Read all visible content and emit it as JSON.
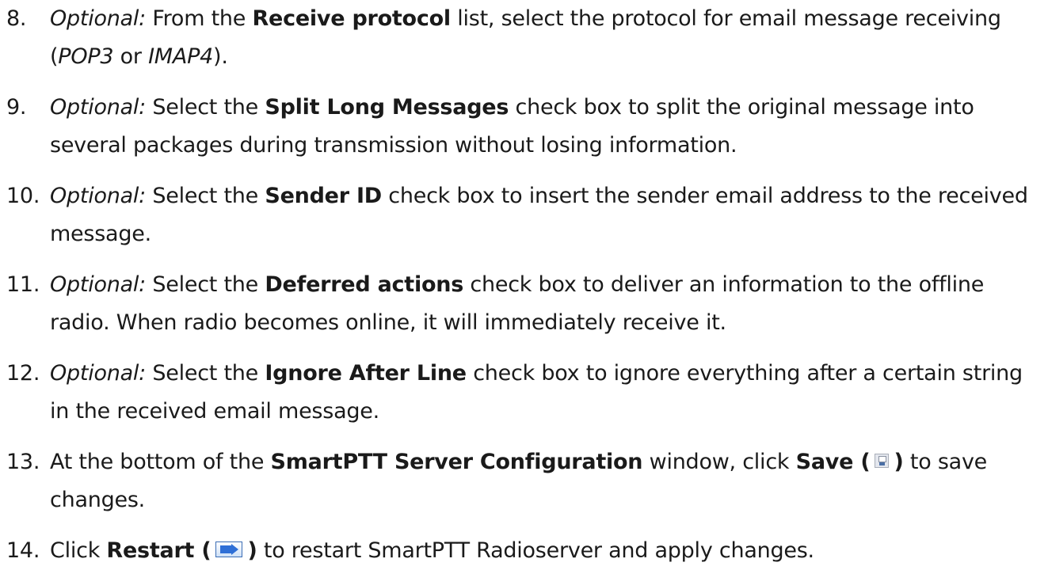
{
  "steps": [
    {
      "number": "8.",
      "optional_label": "Optional:",
      "text_a": " From the ",
      "bold_a": "Receive protocol",
      "text_b": " list, select the protocol for email message receiving",
      "paren_open": "(",
      "italic_1": "POP3",
      "text_c": " or ",
      "italic_2": "IMAP4",
      "paren_close": ")."
    },
    {
      "number": "9.",
      "optional_label": "Optional:",
      "text_a": " Select the ",
      "bold_a": "Split Long Messages",
      "text_b": " check box to split the original message into",
      "line2": "several packages during transmission without losing information."
    },
    {
      "number": "10.",
      "optional_label": "Optional:",
      "text_a": " Select the ",
      "bold_a": "Sender ID",
      "text_b": " check box to insert the sender email address to the received",
      "line2": "message."
    },
    {
      "number": "11.",
      "optional_label": "Optional:",
      "text_a": " Select the ",
      "bold_a": "Deferred actions",
      "text_b": " check box to deliver an information to the offline",
      "line2": "radio. When radio becomes online, it will immediately receive it."
    },
    {
      "number": "12.",
      "optional_label": "Optional:",
      "text_a": " Select the ",
      "bold_a": "Ignore After Line",
      "text_b": " check box to ignore everything after a certain string",
      "line2": "in the received email message."
    },
    {
      "number": "13.",
      "text_a": "At the bottom of the ",
      "bold_a": "SmartPTT Server Configuration",
      "text_b": " window, click ",
      "bold_b": "Save (",
      "icon": "save-icon",
      "bold_c": ")",
      "text_c": " to save",
      "line2": "changes."
    },
    {
      "number": "14.",
      "text_a": "Click ",
      "bold_a": "Restart (",
      "icon": "restart-icon",
      "bold_b": ")",
      "text_b": " to restart SmartPTT Radioserver and apply changes."
    }
  ]
}
